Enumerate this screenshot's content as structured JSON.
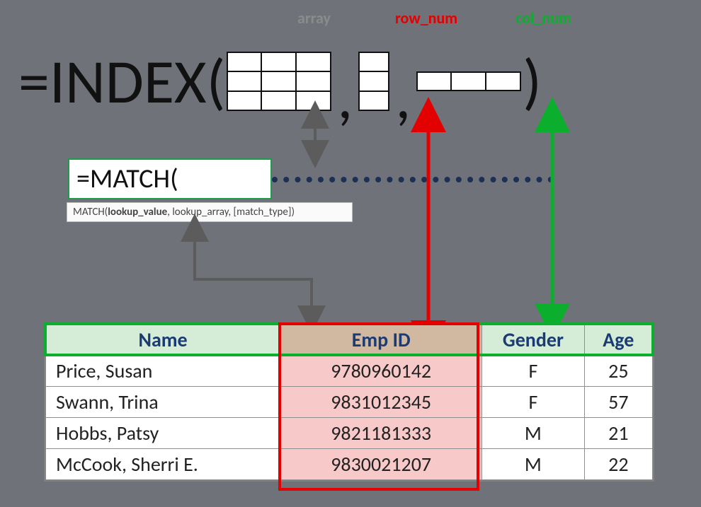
{
  "args": {
    "array": "array",
    "row": "row_num",
    "col": "col_num"
  },
  "formula": {
    "prefix": "=INDEX(",
    "comma": ",",
    "close": ")"
  },
  "match": {
    "cell": "=MATCH(",
    "tooltip_pre": "MATCH(",
    "tooltip_bold": "lookup_value",
    "tooltip_post": ", lookup_array, [match_type])"
  },
  "table": {
    "headers": {
      "name": "Name",
      "emp": "Emp ID",
      "gender": "Gender",
      "age": "Age"
    },
    "rows": [
      {
        "name": "Price, Susan",
        "emp": "9780960142",
        "gender": "F",
        "age": "25"
      },
      {
        "name": "Swann, Trina",
        "emp": "9831012345",
        "gender": "F",
        "age": "57"
      },
      {
        "name": "Hobbs, Patsy",
        "emp": "9821181333",
        "gender": "M",
        "age": "21"
      },
      {
        "name": "McCook, Sherri E.",
        "emp": "9830021207",
        "gender": "M",
        "age": "22"
      }
    ]
  }
}
